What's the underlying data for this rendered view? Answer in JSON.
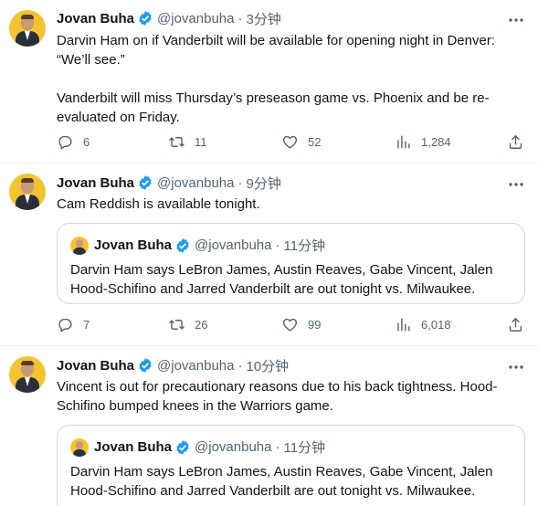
{
  "tweets": [
    {
      "name": "Jovan Buha",
      "handle": "@jovanbuha",
      "time": "3分钟",
      "text_lines": [
        "Darvin Ham on if Vanderbilt will be available for opening night in Denver:",
        "“We’ll see.”",
        "",
        "Vanderbilt will miss Thursday’s preseason game vs. Phoenix and be re-",
        "evaluated on Friday."
      ],
      "replies": "6",
      "retweets": "11",
      "likes": "52",
      "views": "1,284"
    },
    {
      "name": "Jovan Buha",
      "handle": "@jovanbuha",
      "time": "9分钟",
      "text_lines": [
        "Cam Reddish is available tonight."
      ],
      "quote": {
        "name": "Jovan Buha",
        "handle": "@jovanbuha",
        "time": "11分钟",
        "text_lines": [
          "Darvin Ham says LeBron James, Austin Reaves, Gabe Vincent, Jalen",
          "Hood-Schifino and Jarred Vanderbilt are out tonight vs. Milwaukee."
        ]
      },
      "replies": "7",
      "retweets": "26",
      "likes": "99",
      "views": "6,018"
    },
    {
      "name": "Jovan Buha",
      "handle": "@jovanbuha",
      "time": "10分钟",
      "text_lines": [
        "Vincent is out for precautionary reasons due to his back tightness. Hood-",
        "Schifino bumped knees in the Warriors game."
      ],
      "quote": {
        "name": "Jovan Buha",
        "handle": "@jovanbuha",
        "time": "11分钟",
        "text_lines": [
          "Darvin Ham says LeBron James, Austin Reaves, Gabe Vincent, Jalen",
          "Hood-Schifino and Jarred Vanderbilt are out tonight vs. Milwaukee."
        ]
      }
    }
  ],
  "colors": {
    "verified": "#1d9bf0",
    "muted": "#536471",
    "border": "#cfd9de"
  },
  "icons": [
    "verified-badge-icon",
    "more-icon",
    "reply-icon",
    "retweet-icon",
    "like-icon",
    "views-icon",
    "share-icon"
  ]
}
